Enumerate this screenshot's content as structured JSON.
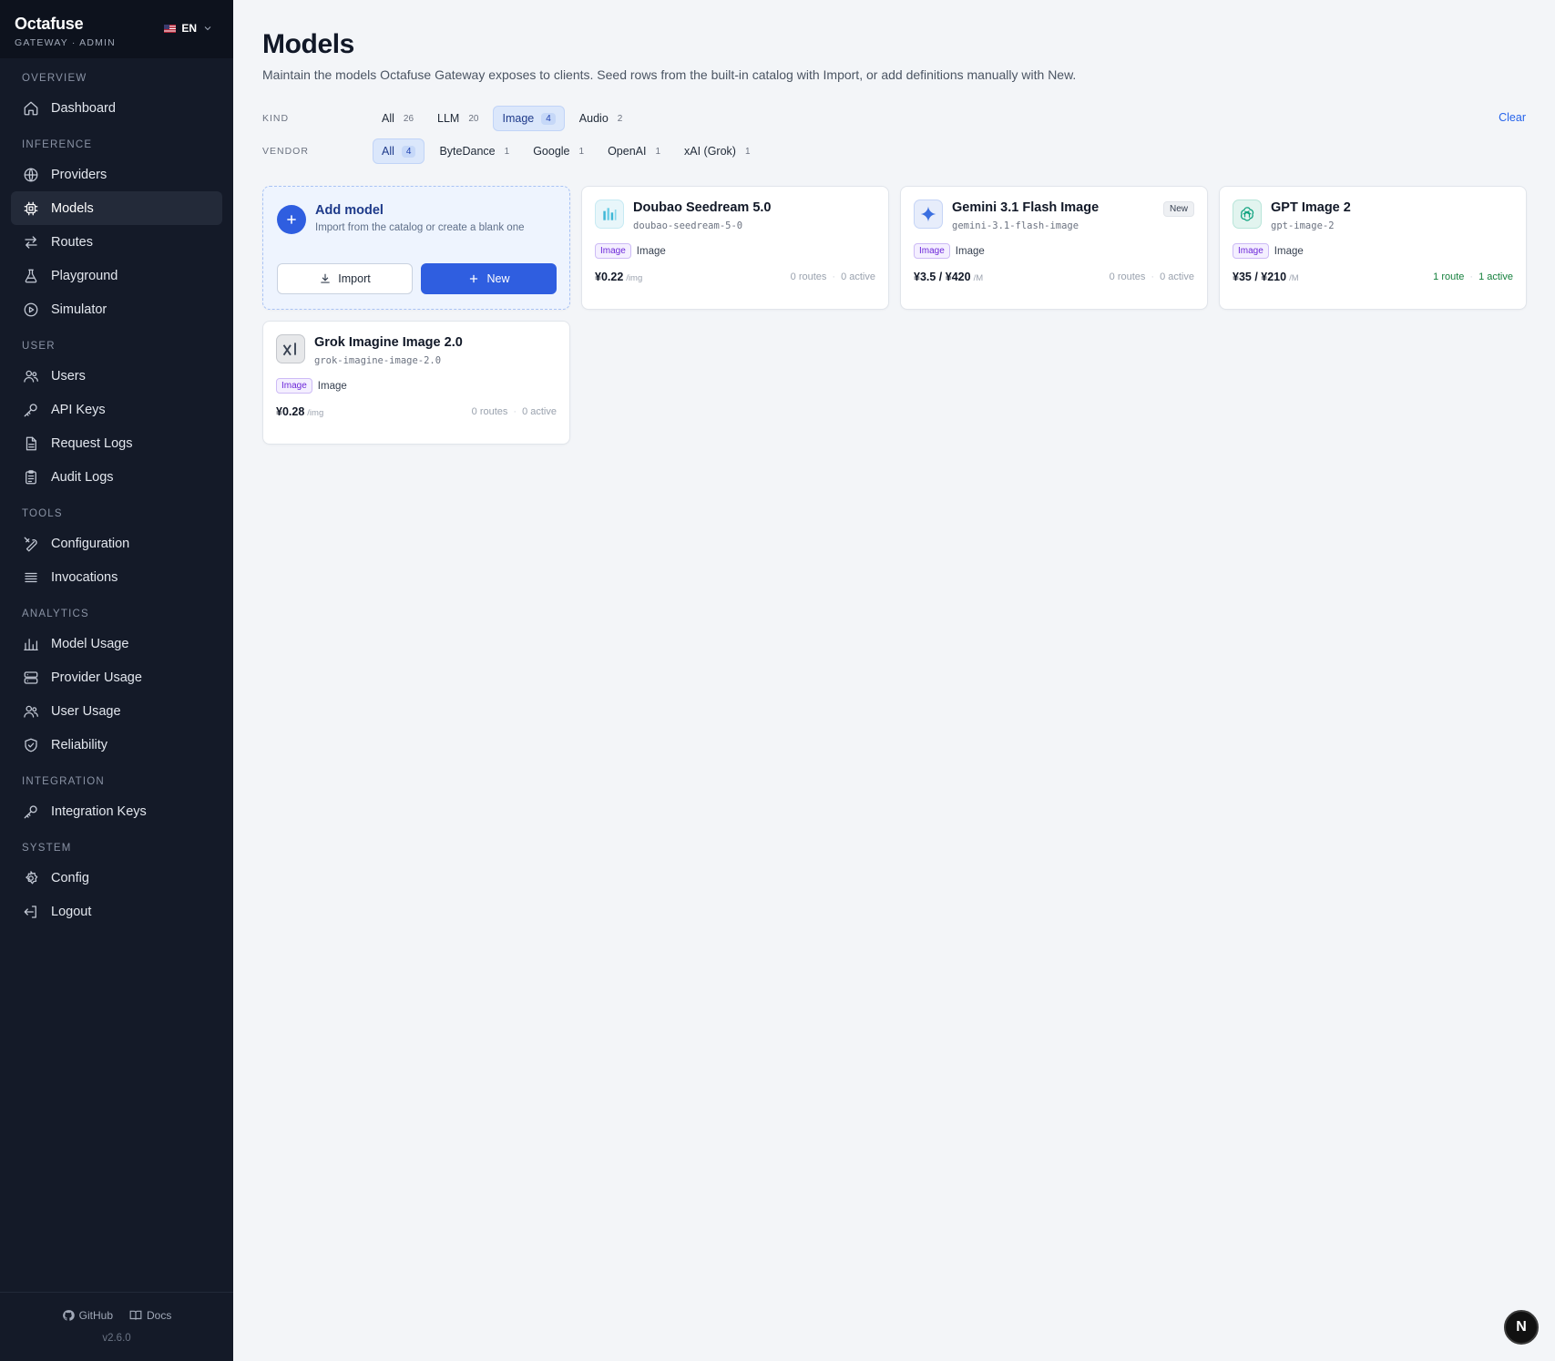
{
  "brand": {
    "name": "Octafuse",
    "sub": "GATEWAY · ADMIN",
    "lang": "EN"
  },
  "nav": [
    {
      "section": "OVERVIEW",
      "items": [
        {
          "label": "Dashboard",
          "icon": "home-icon"
        }
      ]
    },
    {
      "section": "INFERENCE",
      "items": [
        {
          "label": "Providers",
          "icon": "globe-icon"
        },
        {
          "label": "Models",
          "icon": "cpu-icon",
          "active": true
        },
        {
          "label": "Routes",
          "icon": "arrows-icon"
        },
        {
          "label": "Playground",
          "icon": "flask-icon"
        },
        {
          "label": "Simulator",
          "icon": "play-circle-icon"
        }
      ]
    },
    {
      "section": "USER",
      "items": [
        {
          "label": "Users",
          "icon": "users-icon"
        },
        {
          "label": "API Keys",
          "icon": "key-icon"
        },
        {
          "label": "Request Logs",
          "icon": "file-icon"
        },
        {
          "label": "Audit Logs",
          "icon": "clipboard-icon"
        }
      ]
    },
    {
      "section": "TOOLS",
      "items": [
        {
          "label": "Configuration",
          "icon": "tools-icon"
        },
        {
          "label": "Invocations",
          "icon": "list-icon"
        }
      ]
    },
    {
      "section": "ANALYTICS",
      "items": [
        {
          "label": "Model Usage",
          "icon": "bar-chart-icon"
        },
        {
          "label": "Provider Usage",
          "icon": "server-icon"
        },
        {
          "label": "User Usage",
          "icon": "users-icon"
        },
        {
          "label": "Reliability",
          "icon": "shield-icon"
        }
      ]
    },
    {
      "section": "INTEGRATION",
      "items": [
        {
          "label": "Integration Keys",
          "icon": "key-icon"
        }
      ]
    },
    {
      "section": "SYSTEM",
      "items": [
        {
          "label": "Config",
          "icon": "gear-icon"
        },
        {
          "label": "Logout",
          "icon": "logout-icon"
        }
      ]
    }
  ],
  "footer": {
    "github": "GitHub",
    "docs": "Docs",
    "version": "v2.6.0"
  },
  "page": {
    "title": "Models",
    "description": "Maintain the models Octafuse Gateway exposes to clients. Seed rows from the built-in catalog with Import, or add definitions manually with New."
  },
  "filters": {
    "kind_label": "KIND",
    "kind": [
      {
        "label": "All",
        "count": "26"
      },
      {
        "label": "LLM",
        "count": "20"
      },
      {
        "label": "Image",
        "count": "4",
        "active": true
      },
      {
        "label": "Audio",
        "count": "2"
      }
    ],
    "vendor_label": "VENDOR",
    "vendor": [
      {
        "label": "All",
        "count": "4",
        "active": true
      },
      {
        "label": "ByteDance",
        "count": "1"
      },
      {
        "label": "Google",
        "count": "1"
      },
      {
        "label": "OpenAI",
        "count": "1"
      },
      {
        "label": "xAI (Grok)",
        "count": "1"
      }
    ],
    "clear": "Clear"
  },
  "add_card": {
    "title": "Add model",
    "subtitle": "Import from the catalog or create a blank one",
    "import": "Import",
    "new": "New"
  },
  "models": [
    {
      "name": "Doubao Seedream 5.0",
      "id": "doubao-seedream-5-0",
      "tag": "Image",
      "kind": "Image",
      "price": "¥0.22",
      "unit": "/img",
      "routes": "0 routes",
      "active": "0 active",
      "logo": "bytedance-icon",
      "logo_color": "#3fb8d6"
    },
    {
      "name": "Gemini 3.1 Flash Image",
      "id": "gemini-3.1-flash-image",
      "tag": "Image",
      "kind": "Image",
      "price": "¥3.5 / ¥420",
      "unit": "/M",
      "routes": "0 routes",
      "active": "0 active",
      "badge": "New",
      "logo": "gemini-sparkle-icon",
      "logo_color": "#3b6fe0"
    },
    {
      "name": "GPT Image 2",
      "id": "gpt-image-2",
      "tag": "Image",
      "kind": "Image",
      "price": "¥35 / ¥210",
      "unit": "/M",
      "routes": "1 route",
      "active": "1 active",
      "live": true,
      "logo": "openai-icon",
      "logo_color": "#10a37f"
    },
    {
      "name": "Grok Imagine Image 2.0",
      "id": "grok-imagine-image-2.0",
      "tag": "Image",
      "kind": "Image",
      "price": "¥0.28",
      "unit": "/img",
      "routes": "0 routes",
      "active": "0 active",
      "logo": "xai-icon",
      "logo_color": "#374151"
    }
  ],
  "fab": "N"
}
